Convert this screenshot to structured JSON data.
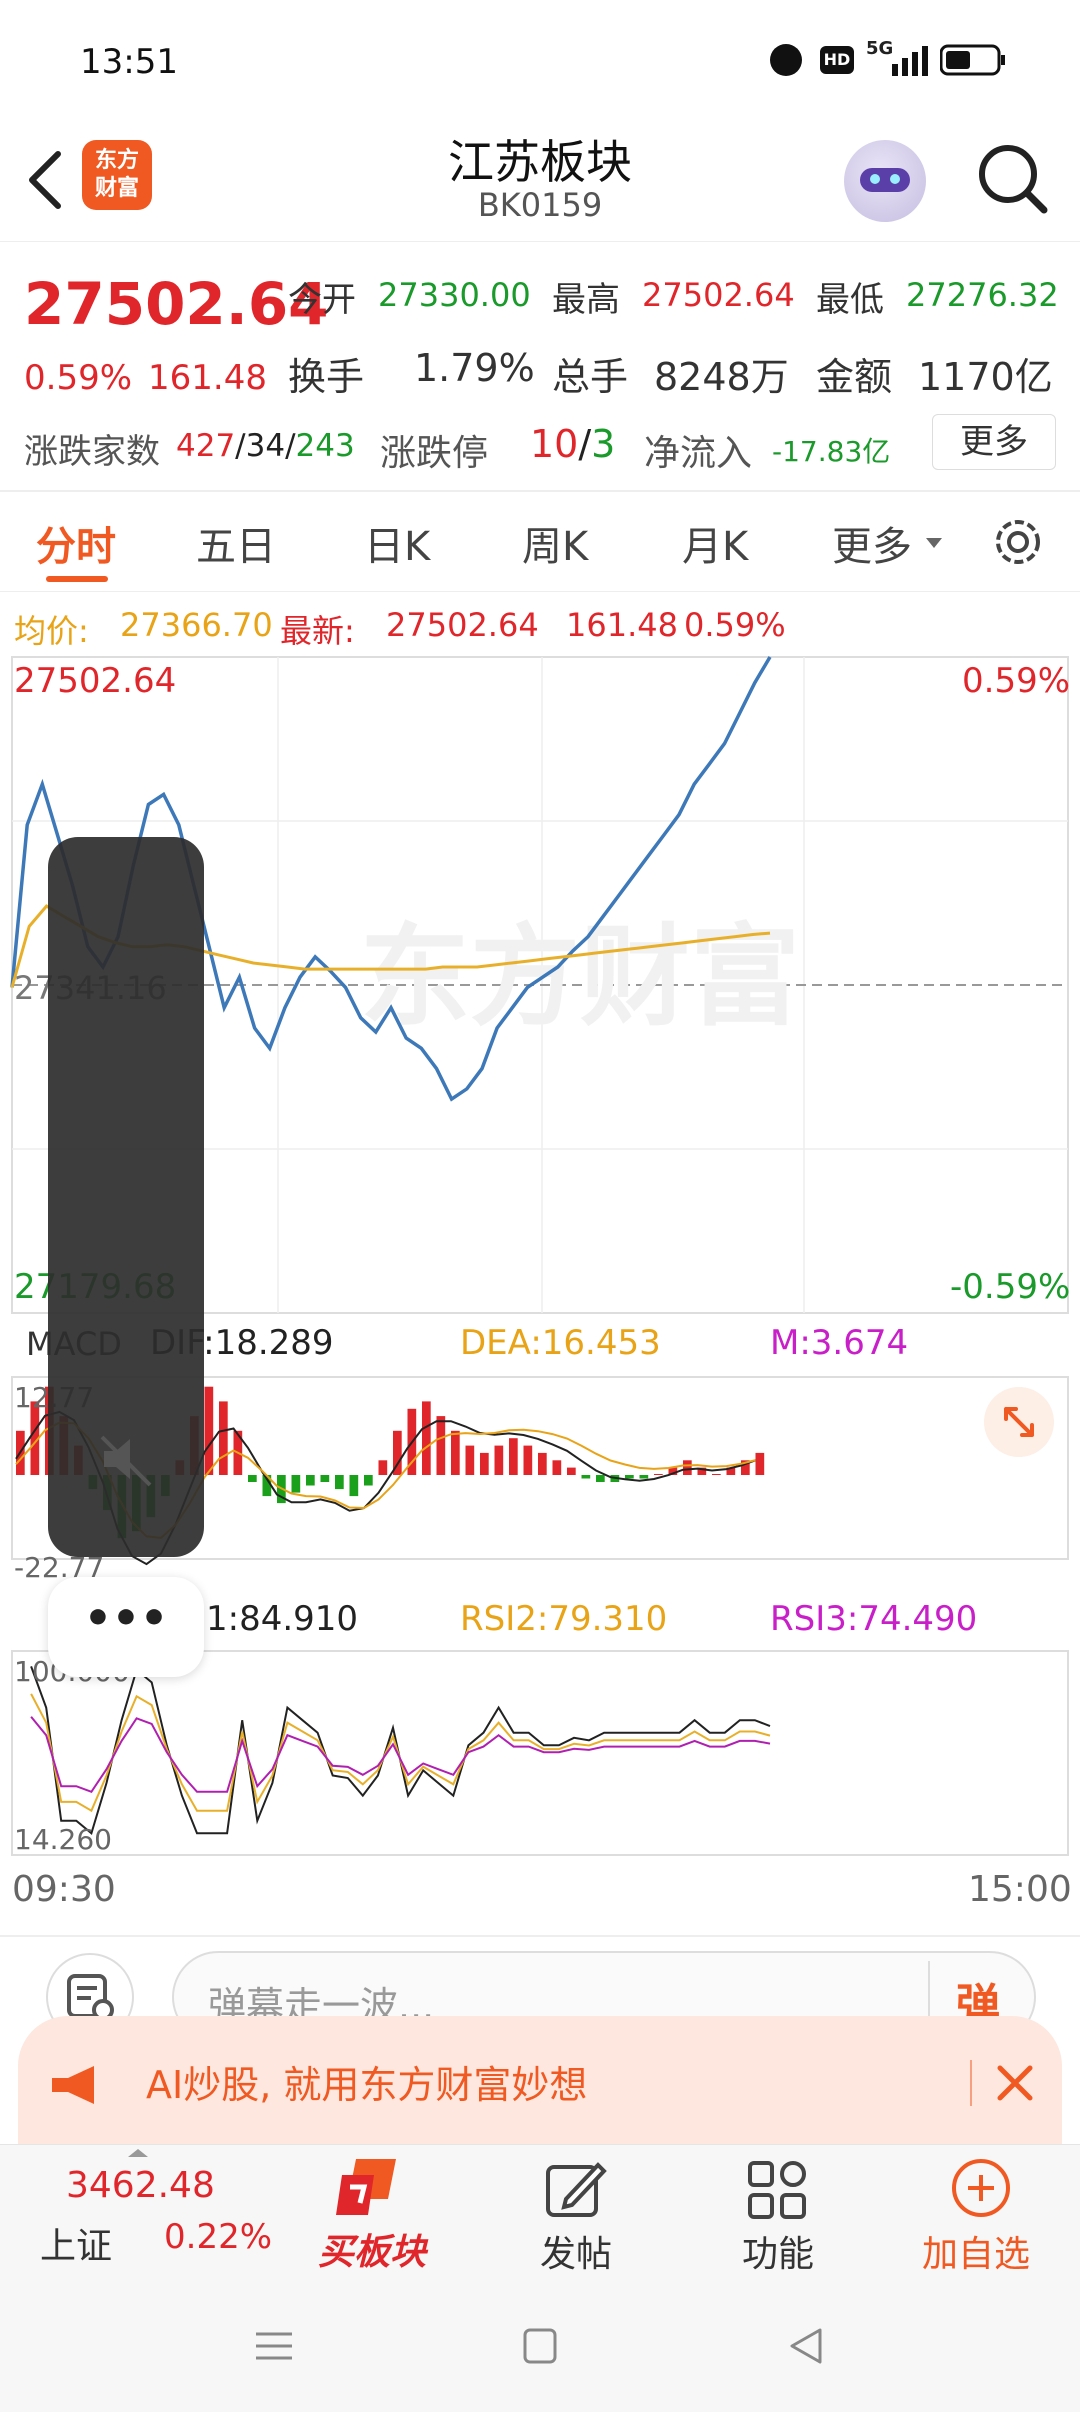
{
  "status_bar": {
    "time": "13:51",
    "network": "5G"
  },
  "header": {
    "title": "江苏板块",
    "code": "BK0159",
    "logo_text_top": "东方",
    "logo_text_bottom": "财富"
  },
  "quote": {
    "price": "27502.64",
    "change_pct": "0.59%",
    "change": "161.48",
    "open_label": "今开",
    "open": "27330.00",
    "high_label": "最高",
    "high": "27502.64",
    "low_label": "最低",
    "low": "27276.32",
    "turnover_label": "换手",
    "turnover": "1.79%",
    "volume_label": "总手",
    "volume": "8248万",
    "amount_label": "金额",
    "amount": "1170亿",
    "breadth_label": "涨跌家数",
    "up_count": "427",
    "flat_count": "34",
    "down_count": "243",
    "limit_label": "涨跌停",
    "limit_up": "10",
    "limit_down": "3",
    "netflow_label": "净流入",
    "netflow": "-17.83亿",
    "more_button": "更多"
  },
  "tabs": {
    "intraday": "分时",
    "five_day": "五日",
    "day_k": "日K",
    "week_k": "周K",
    "month_k": "月K",
    "more": "更多"
  },
  "info_line": {
    "avg_label": "均价:",
    "avg": "27366.70",
    "latest_label": "最新:",
    "latest": "27502.64",
    "change": "161.48",
    "change_pct": "0.59%"
  },
  "chart_data": [
    {
      "type": "line",
      "title": "",
      "ylim": [
        27179.68,
        27502.64
      ],
      "y_labels": {
        "top": "27502.64",
        "mid": "27341.16",
        "bottom": "27179.68"
      },
      "pct_labels": {
        "top": "0.59%",
        "bottom": "-0.59%"
      },
      "x_labels": {
        "start": "09:30",
        "end": "15:00"
      },
      "series": [
        {
          "name": "最新",
          "color": "#3d78b8",
          "values": [
            27340,
            27420,
            27440,
            27415,
            27390,
            27360,
            27350,
            27365,
            27400,
            27430,
            27435,
            27420,
            27390,
            27360,
            27330,
            27345,
            27320,
            27310,
            27330,
            27345,
            27355,
            27348,
            27340,
            27325,
            27318,
            27330,
            27315,
            27310,
            27300,
            27285,
            27290,
            27300,
            27320,
            27330,
            27340,
            27345,
            27350,
            27358,
            27365,
            27375,
            27385,
            27395,
            27405,
            27415,
            27425,
            27440,
            27450,
            27460,
            27475,
            27490,
            27502.64
          ]
        },
        {
          "name": "均价",
          "color": "#e8b02a",
          "values": [
            27340,
            27370,
            27380,
            27375,
            27370,
            27365,
            27362,
            27360,
            27360,
            27361,
            27360,
            27358,
            27356,
            27354,
            27352,
            27351,
            27350,
            27349,
            27349,
            27349,
            27349,
            27349,
            27349,
            27349,
            27349,
            27350,
            27350,
            27350,
            27351,
            27352,
            27353,
            27354,
            27355,
            27356,
            27357,
            27358,
            27359,
            27360,
            27361,
            27362,
            27363,
            27364,
            27365,
            27366,
            27366.7
          ]
        }
      ]
    },
    {
      "type": "bar",
      "title": "MACD",
      "labels": {
        "dif": "DIF:18.289",
        "dea": "DEA:16.453",
        "m": "M:3.674",
        "top": "12.77",
        "bottom": "-22.77"
      },
      "ylim": [
        -22.77,
        12.77
      ],
      "values": [
        6,
        10,
        12,
        8,
        4,
        -4,
        -10,
        -18,
        -16,
        -12,
        -6,
        2,
        8,
        12,
        10,
        6,
        -2,
        -6,
        -8,
        -5,
        -3,
        -2,
        -4,
        -6,
        -3,
        2,
        6,
        9,
        10,
        8,
        6,
        4,
        3,
        4,
        5,
        4,
        3,
        2,
        1,
        -1,
        -2,
        -2,
        -1,
        -1,
        0,
        1,
        2,
        1,
        0,
        1,
        2,
        3
      ]
    },
    {
      "type": "line",
      "title": "RSI",
      "labels": {
        "rsi1": "1:84.910",
        "rsi2": "RSI2:79.310",
        "rsi3": "RSI3:74.490",
        "top": "100.000",
        "bottom": "14.260"
      },
      "ylim": [
        14.26,
        100
      ]
    }
  ],
  "danmaku": {
    "placeholder": "弹幕走一波...",
    "send_label": "弹"
  },
  "ad": {
    "text": "AI炒股, 就用东方财富妙想"
  },
  "bottom_nav": {
    "index_value": "3462.48",
    "index_name": "上证",
    "index_change": "0.22%",
    "buy_label": "买板块",
    "post_label": "发帖",
    "func_label": "功能",
    "add_label": "加自选"
  },
  "watermark": "东方财富"
}
